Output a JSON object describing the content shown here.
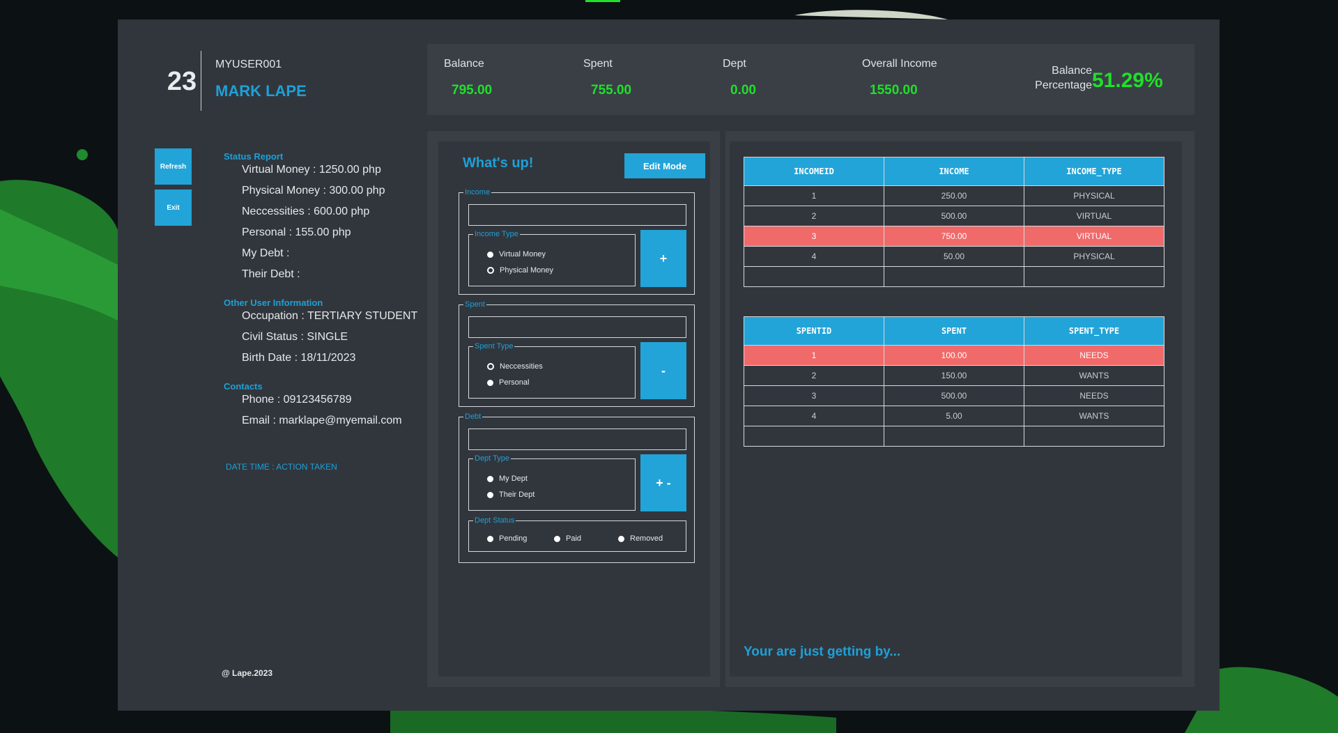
{
  "user": {
    "number": "23",
    "id": "MYUSER001",
    "name": "MARK LAPE"
  },
  "stats": {
    "balance": {
      "label": "Balance",
      "value": "795.00"
    },
    "spent": {
      "label": "Spent",
      "value": "755.00"
    },
    "dept": {
      "label": "Dept",
      "value": "0.00"
    },
    "overall": {
      "label": "Overall Income",
      "value": "1550.00"
    },
    "percentage": {
      "label_line1": "Balance",
      "label_line2": "Percentage",
      "value": "51.29%"
    }
  },
  "side_buttons": {
    "refresh": "Refresh",
    "exit": "Exit"
  },
  "status_report": {
    "heading": "Status Report",
    "lines": [
      "Virtual Money : 1250.00 php",
      "Physical Money : 300.00 php",
      "Neccessities : 600.00 php",
      "Personal : 155.00 php",
      "My Debt :",
      "Their Debt :"
    ]
  },
  "other_info": {
    "heading": "Other User Information",
    "lines": [
      "Occupation : TERTIARY STUDENT",
      "Civil Status : SINGLE",
      "Birth Date : 18/11/2023"
    ]
  },
  "contacts": {
    "heading": "Contacts",
    "lines": [
      "Phone : 09123456789",
      "Email : marklape@myemail.com"
    ]
  },
  "log_header": "DATE TIME : ACTION TAKEN",
  "footer": "@ Lape.2023",
  "form": {
    "title": "What's up!",
    "edit_button": "Edit Mode",
    "income": {
      "legend": "Income",
      "value": "",
      "type_legend": "Income Type",
      "options": [
        "Virtual Money",
        "Physical Money"
      ],
      "selected": "Physical Money",
      "button": "+"
    },
    "spent": {
      "legend": "Spent",
      "value": "",
      "type_legend": "Spent Type",
      "options": [
        "Neccessities",
        "Personal"
      ],
      "selected": "Neccessities",
      "button": "-"
    },
    "debt": {
      "legend": "Debt",
      "value": "",
      "type_legend": "Dept Type",
      "options": [
        "My Dept",
        "Their Dept"
      ],
      "button": "+ -",
      "status_legend": "Dept Status",
      "status_options": [
        "Pending",
        "Paid",
        "Removed"
      ]
    }
  },
  "income_table": {
    "columns": [
      "INCOMEID",
      "INCOME",
      "INCOME_TYPE"
    ],
    "rows": [
      [
        "1",
        "250.00",
        "PHYSICAL"
      ],
      [
        "2",
        "500.00",
        "VIRTUAL"
      ],
      [
        "3",
        "750.00",
        "VIRTUAL"
      ],
      [
        "4",
        "50.00",
        "PHYSICAL"
      ],
      [
        "",
        "",
        ""
      ]
    ],
    "highlighted_row": 3
  },
  "spent_table": {
    "columns": [
      "SPENTID",
      "SPENT",
      "SPENT_TYPE"
    ],
    "rows": [
      [
        "1",
        "100.00",
        "NEEDS"
      ],
      [
        "2",
        "150.00",
        "WANTS"
      ],
      [
        "3",
        "500.00",
        "NEEDS"
      ],
      [
        "4",
        "5.00",
        "WANTS"
      ],
      [
        "",
        "",
        ""
      ]
    ],
    "highlighted_row": 1
  },
  "status_message": "Your are just getting by...",
  "colors": {
    "accent": "#22a4d8",
    "positive": "#1fe02a",
    "highlight": "#f16a6a",
    "panel": "#31363d"
  }
}
